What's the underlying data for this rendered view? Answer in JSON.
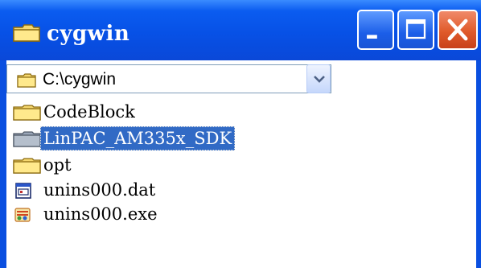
{
  "window": {
    "title": "cygwin",
    "controls": [
      "minimize",
      "maximize",
      "close"
    ]
  },
  "address_bar": {
    "path": "C:\\cygwin",
    "icon": "folder-icon"
  },
  "files": [
    {
      "name": "CodeBlock",
      "icon": "folder-icon",
      "selected": false
    },
    {
      "name": "LinPAC_AM335x_SDK",
      "icon": "folder-icon",
      "selected": true
    },
    {
      "name": "opt",
      "icon": "folder-icon",
      "selected": false
    },
    {
      "name": "unins000.dat",
      "icon": "dat-file-icon",
      "selected": false
    },
    {
      "name": "unins000.exe",
      "icon": "exe-file-icon",
      "selected": false
    }
  ],
  "colors": {
    "titlebar": "#0751e6",
    "selection": "#316ac5",
    "close_button": "#e05a2a"
  }
}
